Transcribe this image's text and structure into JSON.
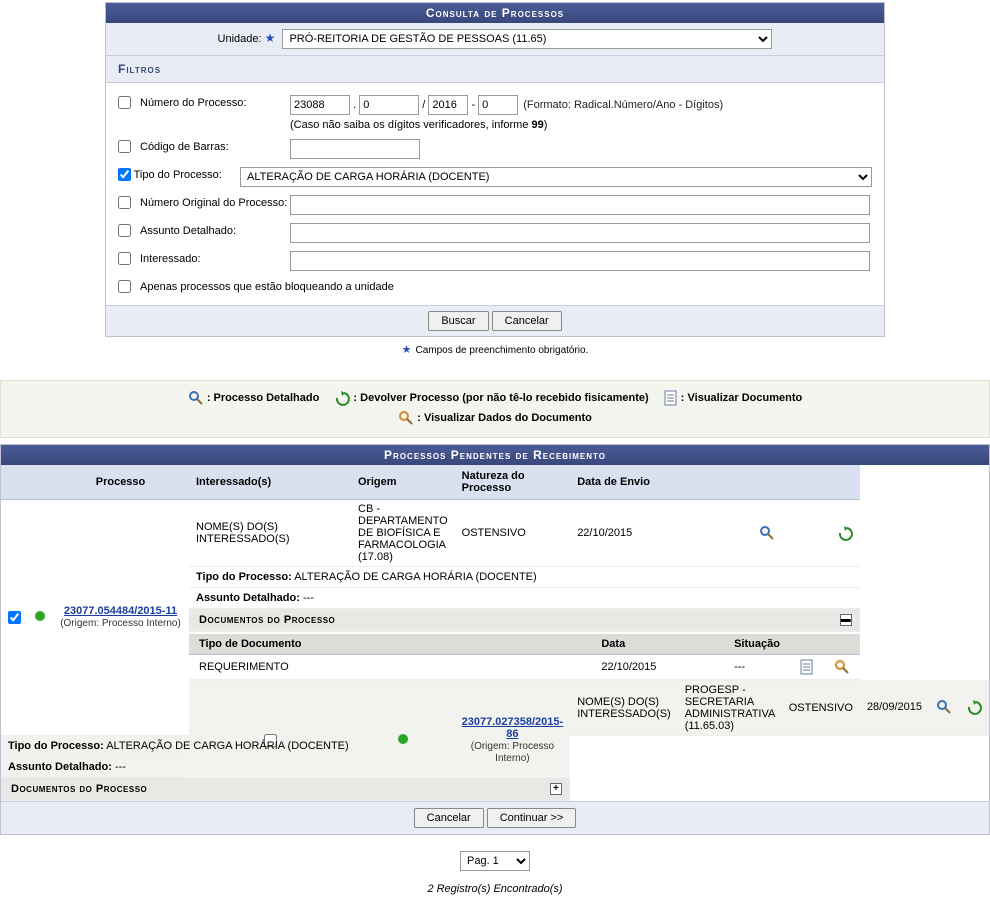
{
  "header": {
    "title": "Consulta de Processos",
    "unidade_label": "Unidade:",
    "unidade_value": "PRÓ-REITORIA DE GESTÃO DE PESSOAS (11.65)"
  },
  "filtros": {
    "title": "Filtros",
    "numero_label": "Número do Processo:",
    "radical": "23088",
    "numero": "0",
    "ano": "2016",
    "digitos": "0",
    "formato_hint": "(Formato: Radical.Número/Ano - Dígitos)",
    "digitos_hint_a": "(Caso não saiba os dígitos verificadores, informe ",
    "digitos_hint_b": "99",
    "digitos_hint_c": ")",
    "codigo_label": "Código de Barras:",
    "tipo_label": "Tipo do Processo:",
    "tipo_value": "ALTERAÇÃO DE CARGA HORÁRIA (DOCENTE)",
    "num_original_label": "Número Original do Processo:",
    "assunto_label": "Assunto Detalhado:",
    "interessado_label": "Interessado:",
    "bloq_label": "Apenas processos que estão bloqueando a unidade",
    "buscar": "Buscar",
    "cancelar": "Cancelar"
  },
  "mandatory_note": "Campos de preenchimento obrigatório.",
  "legend": {
    "detalhado": ": Processo Detalhado",
    "devolver": ": Devolver Processo (por não tê-lo recebido fisicamente)",
    "visualizar_doc": ": Visualizar Documento",
    "visualizar_dados": ": Visualizar Dados do Documento"
  },
  "table": {
    "title": "Processos Pendentes de Recebimento",
    "cols": {
      "processo": "Processo",
      "interessados": "Interessado(s)",
      "origem": "Origem",
      "natureza": "Natureza do Processo",
      "envio": "Data de Envio"
    },
    "tipo_prefix": "Tipo do Processo:",
    "assunto_prefix": "Assunto Detalhado:",
    "docs_section": "Documentos do Processo",
    "docs_cols": {
      "tipo": "Tipo de Documento",
      "data": "Data",
      "situacao": "Situação"
    },
    "rows": [
      {
        "checked": true,
        "numero": "23077.054484/2015-11",
        "origem_txt": "(Origem: Processo Interno)",
        "interessado": "NOME(S) DO(S) INTERESSADO(S)",
        "origem": "CB - DEPARTAMENTO DE BIOFÍSICA E FARMACOLOGIA (17.08)",
        "natureza": "OSTENSIVO",
        "envio": "22/10/2015",
        "tipo_proc": "ALTERAÇÃO DE CARGA HORÁRIA (DOCENTE)",
        "assunto": "---",
        "docs_open": true,
        "docs": [
          {
            "tipo": "REQUERIMENTO",
            "data": "22/10/2015",
            "situacao": "---"
          }
        ]
      },
      {
        "checked": false,
        "numero": "23077.027358/2015-86",
        "origem_txt": "(Origem: Processo Interno)",
        "interessado": "NOME(S) DO(S) INTERESSADO(S)",
        "origem": "PROGESP - SECRETARIA ADMINISTRATIVA (11.65.03)",
        "natureza": "OSTENSIVO",
        "envio": "28/09/2015",
        "tipo_proc": "ALTERAÇÃO DE CARGA HORÁRIA (DOCENTE)",
        "assunto": "---",
        "docs_open": false,
        "docs": []
      }
    ]
  },
  "footer": {
    "cancelar": "Cancelar",
    "continuar": "Continuar >>",
    "pagina_label": "Pag. 1",
    "count": "2 Registro(s) Encontrado(s)"
  }
}
